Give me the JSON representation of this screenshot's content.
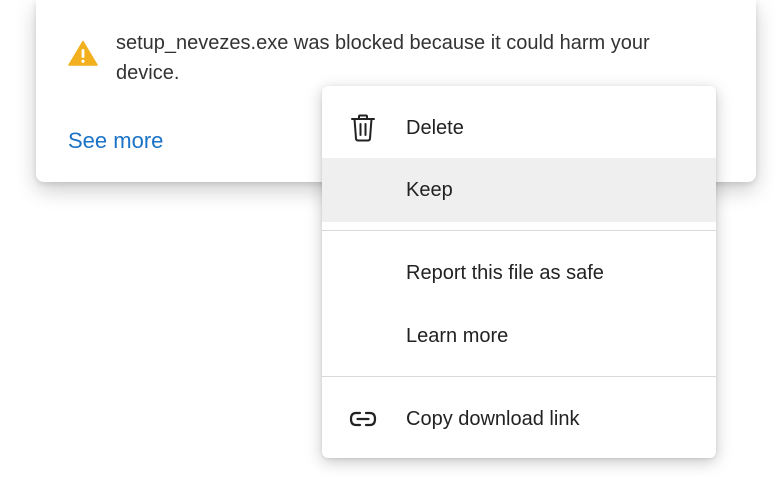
{
  "notification": {
    "message": "setup_nevezes.exe was blocked because it could harm your device.",
    "see_more_label": "See more",
    "warning_color": "#f2b01e",
    "link_color": "#1a73c7"
  },
  "context_menu": {
    "items": [
      {
        "label": "Delete",
        "icon": "trash-icon"
      },
      {
        "label": "Keep",
        "icon": "",
        "highlighted": true
      },
      {
        "label": "Report this file as safe",
        "icon": ""
      },
      {
        "label": "Learn more",
        "icon": ""
      },
      {
        "label": "Copy download link",
        "icon": "link-icon"
      }
    ]
  }
}
